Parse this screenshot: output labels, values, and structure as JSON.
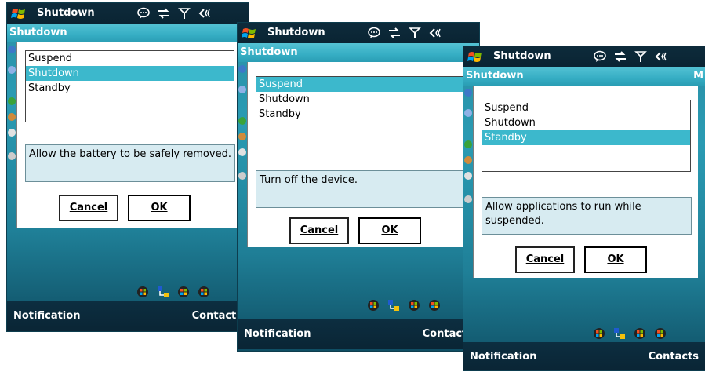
{
  "screens": [
    {
      "app_title": "Shutdown",
      "dialog_title": "Shutdown",
      "options": [
        "Suspend",
        "Shutdown",
        "Standby"
      ],
      "selected_index": 1,
      "description": "Allow the battery to be safely removed.",
      "buttons": {
        "cancel": "Cancel",
        "ok": "OK"
      },
      "softkeys": {
        "left": "Notification",
        "right": "Contacts"
      }
    },
    {
      "app_title": "Shutdown",
      "dialog_title": "Shutdown",
      "options": [
        "Suspend",
        "Shutdown",
        "Standby"
      ],
      "selected_index": 0,
      "description": "Turn off the device.",
      "buttons": {
        "cancel": "Cancel",
        "ok": "OK"
      },
      "softkeys": {
        "left": "Notification",
        "right": "Contacts"
      }
    },
    {
      "app_title": "Shutdown",
      "dialog_title": "Shutdown",
      "dialog_title_suffix": "M",
      "options": [
        "Suspend",
        "Shutdown",
        "Standby"
      ],
      "selected_index": 2,
      "description": "Allow applications to run while suspended.",
      "buttons": {
        "cancel": "Cancel",
        "ok": "OK"
      },
      "softkeys": {
        "left": "Notification",
        "right": "Contacts"
      }
    }
  ],
  "icons": [
    "windows-start-icon",
    "message-icon",
    "sync-icon",
    "signal-icon",
    "volume-icon"
  ],
  "colors": {
    "accent": "#3cb8cc",
    "titlebar": "#0d2b3b",
    "description_bg": "#d7ebf1"
  }
}
